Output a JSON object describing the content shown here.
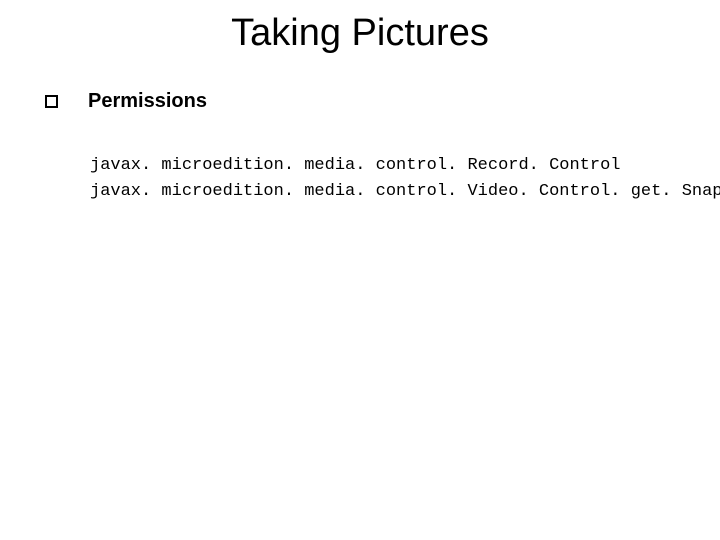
{
  "slide": {
    "title": "Taking Pictures",
    "bullet": {
      "label": "Permissions"
    },
    "code": {
      "line1": "javax. microedition. media. control. Record. Control",
      "line2": "javax. microedition. media. control. Video. Control. get. Snapshot"
    }
  }
}
